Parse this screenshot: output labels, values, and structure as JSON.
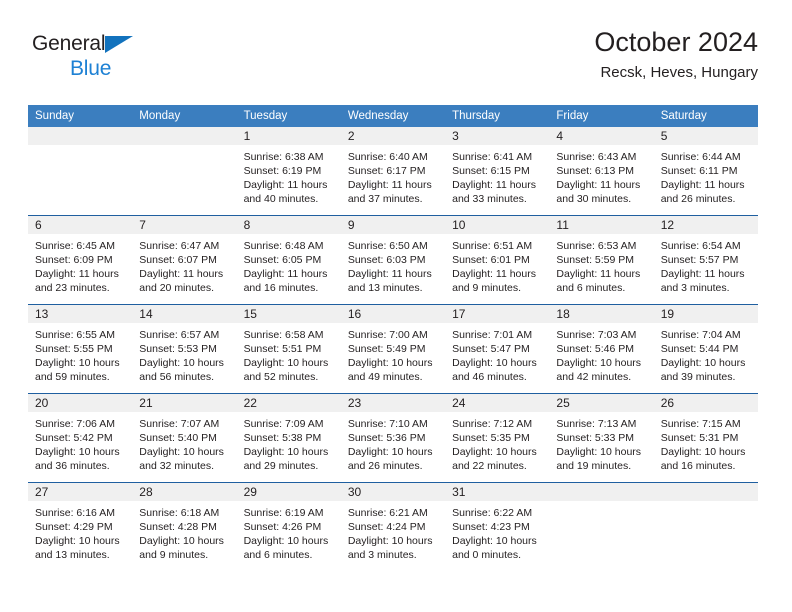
{
  "brand": {
    "line1": "General",
    "line2": "Blue",
    "triangle_color": "#1272bd",
    "line2_color": "#1e81d4"
  },
  "header": {
    "title": "October 2024",
    "subtitle": "Recsk, Heves, Hungary"
  },
  "theme": {
    "header_blue": "#3b7ebf",
    "rule_blue": "#1f5fa0",
    "daynum_band": "#f0f0f0",
    "text": "#231f20"
  },
  "weekdays": [
    "Sunday",
    "Monday",
    "Tuesday",
    "Wednesday",
    "Thursday",
    "Friday",
    "Saturday"
  ],
  "weeks": [
    [
      {
        "day": "",
        "lines": [
          "",
          "",
          "",
          ""
        ],
        "empty": true
      },
      {
        "day": "",
        "lines": [
          "",
          "",
          "",
          ""
        ],
        "empty": true
      },
      {
        "day": "1",
        "lines": [
          "Sunrise: 6:38 AM",
          "Sunset: 6:19 PM",
          "Daylight: 11 hours",
          "and 40 minutes."
        ],
        "empty": false
      },
      {
        "day": "2",
        "lines": [
          "Sunrise: 6:40 AM",
          "Sunset: 6:17 PM",
          "Daylight: 11 hours",
          "and 37 minutes."
        ],
        "empty": false
      },
      {
        "day": "3",
        "lines": [
          "Sunrise: 6:41 AM",
          "Sunset: 6:15 PM",
          "Daylight: 11 hours",
          "and 33 minutes."
        ],
        "empty": false
      },
      {
        "day": "4",
        "lines": [
          "Sunrise: 6:43 AM",
          "Sunset: 6:13 PM",
          "Daylight: 11 hours",
          "and 30 minutes."
        ],
        "empty": false
      },
      {
        "day": "5",
        "lines": [
          "Sunrise: 6:44 AM",
          "Sunset: 6:11 PM",
          "Daylight: 11 hours",
          "and 26 minutes."
        ],
        "empty": false
      }
    ],
    [
      {
        "day": "6",
        "lines": [
          "Sunrise: 6:45 AM",
          "Sunset: 6:09 PM",
          "Daylight: 11 hours",
          "and 23 minutes."
        ],
        "empty": false
      },
      {
        "day": "7",
        "lines": [
          "Sunrise: 6:47 AM",
          "Sunset: 6:07 PM",
          "Daylight: 11 hours",
          "and 20 minutes."
        ],
        "empty": false
      },
      {
        "day": "8",
        "lines": [
          "Sunrise: 6:48 AM",
          "Sunset: 6:05 PM",
          "Daylight: 11 hours",
          "and 16 minutes."
        ],
        "empty": false
      },
      {
        "day": "9",
        "lines": [
          "Sunrise: 6:50 AM",
          "Sunset: 6:03 PM",
          "Daylight: 11 hours",
          "and 13 minutes."
        ],
        "empty": false
      },
      {
        "day": "10",
        "lines": [
          "Sunrise: 6:51 AM",
          "Sunset: 6:01 PM",
          "Daylight: 11 hours",
          "and 9 minutes."
        ],
        "empty": false
      },
      {
        "day": "11",
        "lines": [
          "Sunrise: 6:53 AM",
          "Sunset: 5:59 PM",
          "Daylight: 11 hours",
          "and 6 minutes."
        ],
        "empty": false
      },
      {
        "day": "12",
        "lines": [
          "Sunrise: 6:54 AM",
          "Sunset: 5:57 PM",
          "Daylight: 11 hours",
          "and 3 minutes."
        ],
        "empty": false
      }
    ],
    [
      {
        "day": "13",
        "lines": [
          "Sunrise: 6:55 AM",
          "Sunset: 5:55 PM",
          "Daylight: 10 hours",
          "and 59 minutes."
        ],
        "empty": false
      },
      {
        "day": "14",
        "lines": [
          "Sunrise: 6:57 AM",
          "Sunset: 5:53 PM",
          "Daylight: 10 hours",
          "and 56 minutes."
        ],
        "empty": false
      },
      {
        "day": "15",
        "lines": [
          "Sunrise: 6:58 AM",
          "Sunset: 5:51 PM",
          "Daylight: 10 hours",
          "and 52 minutes."
        ],
        "empty": false
      },
      {
        "day": "16",
        "lines": [
          "Sunrise: 7:00 AM",
          "Sunset: 5:49 PM",
          "Daylight: 10 hours",
          "and 49 minutes."
        ],
        "empty": false
      },
      {
        "day": "17",
        "lines": [
          "Sunrise: 7:01 AM",
          "Sunset: 5:47 PM",
          "Daylight: 10 hours",
          "and 46 minutes."
        ],
        "empty": false
      },
      {
        "day": "18",
        "lines": [
          "Sunrise: 7:03 AM",
          "Sunset: 5:46 PM",
          "Daylight: 10 hours",
          "and 42 minutes."
        ],
        "empty": false
      },
      {
        "day": "19",
        "lines": [
          "Sunrise: 7:04 AM",
          "Sunset: 5:44 PM",
          "Daylight: 10 hours",
          "and 39 minutes."
        ],
        "empty": false
      }
    ],
    [
      {
        "day": "20",
        "lines": [
          "Sunrise: 7:06 AM",
          "Sunset: 5:42 PM",
          "Daylight: 10 hours",
          "and 36 minutes."
        ],
        "empty": false
      },
      {
        "day": "21",
        "lines": [
          "Sunrise: 7:07 AM",
          "Sunset: 5:40 PM",
          "Daylight: 10 hours",
          "and 32 minutes."
        ],
        "empty": false
      },
      {
        "day": "22",
        "lines": [
          "Sunrise: 7:09 AM",
          "Sunset: 5:38 PM",
          "Daylight: 10 hours",
          "and 29 minutes."
        ],
        "empty": false
      },
      {
        "day": "23",
        "lines": [
          "Sunrise: 7:10 AM",
          "Sunset: 5:36 PM",
          "Daylight: 10 hours",
          "and 26 minutes."
        ],
        "empty": false
      },
      {
        "day": "24",
        "lines": [
          "Sunrise: 7:12 AM",
          "Sunset: 5:35 PM",
          "Daylight: 10 hours",
          "and 22 minutes."
        ],
        "empty": false
      },
      {
        "day": "25",
        "lines": [
          "Sunrise: 7:13 AM",
          "Sunset: 5:33 PM",
          "Daylight: 10 hours",
          "and 19 minutes."
        ],
        "empty": false
      },
      {
        "day": "26",
        "lines": [
          "Sunrise: 7:15 AM",
          "Sunset: 5:31 PM",
          "Daylight: 10 hours",
          "and 16 minutes."
        ],
        "empty": false
      }
    ],
    [
      {
        "day": "27",
        "lines": [
          "Sunrise: 6:16 AM",
          "Sunset: 4:29 PM",
          "Daylight: 10 hours",
          "and 13 minutes."
        ],
        "empty": false
      },
      {
        "day": "28",
        "lines": [
          "Sunrise: 6:18 AM",
          "Sunset: 4:28 PM",
          "Daylight: 10 hours",
          "and 9 minutes."
        ],
        "empty": false
      },
      {
        "day": "29",
        "lines": [
          "Sunrise: 6:19 AM",
          "Sunset: 4:26 PM",
          "Daylight: 10 hours",
          "and 6 minutes."
        ],
        "empty": false
      },
      {
        "day": "30",
        "lines": [
          "Sunrise: 6:21 AM",
          "Sunset: 4:24 PM",
          "Daylight: 10 hours",
          "and 3 minutes."
        ],
        "empty": false
      },
      {
        "day": "31",
        "lines": [
          "Sunrise: 6:22 AM",
          "Sunset: 4:23 PM",
          "Daylight: 10 hours",
          "and 0 minutes."
        ],
        "empty": false
      },
      {
        "day": "",
        "lines": [
          "",
          "",
          "",
          ""
        ],
        "empty": true
      },
      {
        "day": "",
        "lines": [
          "",
          "",
          "",
          ""
        ],
        "empty": true
      }
    ]
  ]
}
